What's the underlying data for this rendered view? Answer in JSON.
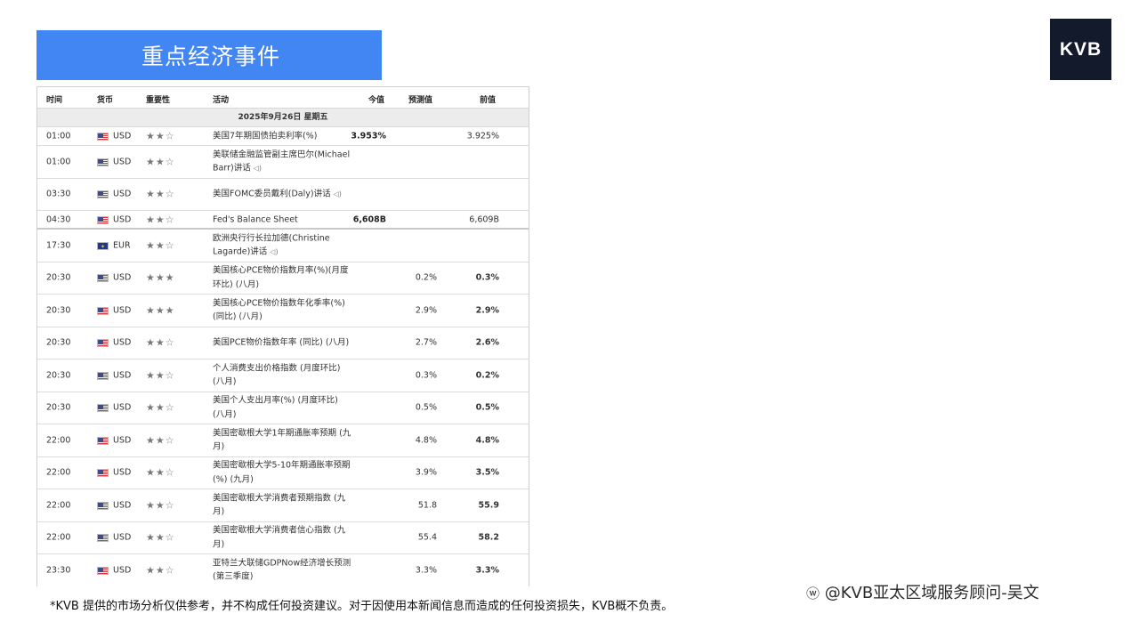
{
  "banner": {
    "title": "重点经济事件"
  },
  "logo": {
    "text": "KVB"
  },
  "table": {
    "headers": {
      "time": "时间",
      "currency": "货币",
      "importance": "重要性",
      "event": "活动",
      "actual": "今值",
      "forecast": "预测值",
      "previous": "前值"
    },
    "date": "2025年9月26日 星期五",
    "rows": [
      {
        "time": "01:00",
        "flag": "us-flag",
        "currency": "USD",
        "stars": "★★☆",
        "event": "美国7年期国债拍卖利率(%)",
        "actual": "3.953%",
        "forecast": "",
        "previous": "3.925%",
        "speaker": false
      },
      {
        "time": "01:00",
        "flag": "us-flag",
        "currency": "USD",
        "stars": "★★☆",
        "event": "美联储金融监管副主席巴尔(Michael Barr)讲话",
        "actual": "",
        "forecast": "",
        "previous": "",
        "speaker": true
      },
      {
        "time": "03:30",
        "flag": "us-flag",
        "currency": "USD",
        "stars": "★★☆",
        "event": "美国FOMC委员戴利(Daly)讲话",
        "actual": "",
        "forecast": "",
        "previous": "",
        "speaker": true
      },
      {
        "time": "04:30",
        "flag": "us-flag",
        "currency": "USD",
        "stars": "★★☆",
        "event": "Fed's Balance Sheet",
        "actual": "6,608B",
        "forecast": "",
        "previous": "6,609B",
        "speaker": false
      },
      {
        "time": "17:30",
        "flag": "eu-flag",
        "currency": "EUR",
        "stars": "★★☆",
        "event": "欧洲央行行长拉加德(Christine Lagarde)讲话",
        "actual": "",
        "forecast": "",
        "previous": "",
        "speaker": true
      },
      {
        "time": "20:30",
        "flag": "us-flag",
        "currency": "USD",
        "stars": "★★★",
        "event": "美国核心PCE物价指数月率(%)(月度环比) (八月)",
        "actual": "",
        "forecast": "0.2%",
        "previous": "0.3%",
        "speaker": false
      },
      {
        "time": "20:30",
        "flag": "us-flag",
        "currency": "USD",
        "stars": "★★★",
        "event": "美国核心PCE物价指数年化季率(%) (同比) (八月)",
        "actual": "",
        "forecast": "2.9%",
        "previous": "2.9%",
        "speaker": false
      },
      {
        "time": "20:30",
        "flag": "us-flag",
        "currency": "USD",
        "stars": "★★☆",
        "event": "美国PCE物价指数年率 (同比) (八月)",
        "actual": "",
        "forecast": "2.7%",
        "previous": "2.6%",
        "speaker": false
      },
      {
        "time": "20:30",
        "flag": "us-flag",
        "currency": "USD",
        "stars": "★★☆",
        "event": "个人消费支出价格指数 (月度环比) (八月)",
        "actual": "",
        "forecast": "0.3%",
        "previous": "0.2%",
        "speaker": false
      },
      {
        "time": "20:30",
        "flag": "us-flag",
        "currency": "USD",
        "stars": "★★☆",
        "event": "美国个人支出月率(%) (月度环比) (八月)",
        "actual": "",
        "forecast": "0.5%",
        "previous": "0.5%",
        "speaker": false
      },
      {
        "time": "22:00",
        "flag": "us-flag",
        "currency": "USD",
        "stars": "★★☆",
        "event": "美国密歇根大学1年期通胀率预期 (九月)",
        "actual": "",
        "forecast": "4.8%",
        "previous": "4.8%",
        "speaker": false
      },
      {
        "time": "22:00",
        "flag": "us-flag",
        "currency": "USD",
        "stars": "★★☆",
        "event": "美国密歇根大学5-10年期通胀率预期(%) (九月)",
        "actual": "",
        "forecast": "3.9%",
        "previous": "3.5%",
        "speaker": false
      },
      {
        "time": "22:00",
        "flag": "us-flag",
        "currency": "USD",
        "stars": "★★☆",
        "event": "美国密歇根大学消费者预期指数 (九月)",
        "actual": "",
        "forecast": "51.8",
        "previous": "55.9",
        "speaker": false
      },
      {
        "time": "22:00",
        "flag": "us-flag",
        "currency": "USD",
        "stars": "★★☆",
        "event": "美国密歇根大学消费者信心指数 (九月)",
        "actual": "",
        "forecast": "55.4",
        "previous": "58.2",
        "speaker": false
      },
      {
        "time": "23:30",
        "flag": "us-flag",
        "currency": "USD",
        "stars": "★★☆",
        "event": "亚特兰大联储GDPNow经济增长预测 (第三季度)",
        "actual": "",
        "forecast": "3.3%",
        "previous": "3.3%",
        "speaker": false
      }
    ]
  },
  "disclaimer": "*KVB 提供的市场分析仅供参考，并不构成任何投资建议。对于因使用本新闻信息而造成的任何投资损失，KVB概不负责。",
  "watermark": "@KVB亚太区域服务顾问-吴文"
}
